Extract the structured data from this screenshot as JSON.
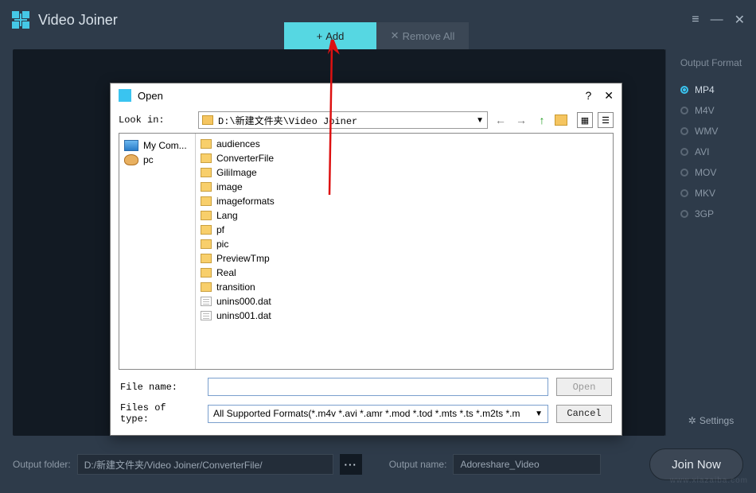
{
  "app": {
    "title": "Video Joiner",
    "win_menu_glyph": "≡",
    "win_min_glyph": "—",
    "win_close_glyph": "✕"
  },
  "tabs": {
    "add_label": "Add",
    "add_glyph": "+",
    "remove_label": "Remove All",
    "remove_glyph": "✕"
  },
  "sidebar": {
    "title": "Output Format",
    "formats": [
      "MP4",
      "M4V",
      "WMV",
      "AVI",
      "MOV",
      "MKV",
      "3GP"
    ],
    "selected_index": 0,
    "settings_label": "Settings"
  },
  "bottom": {
    "output_folder_label": "Output folder:",
    "output_folder_value": "D:/新建文件夹/Video Joiner/ConverterFile/",
    "output_name_label": "Output name:",
    "output_name_value": "Adoreshare_Video",
    "dots_label": "···",
    "join_label": "Join Now"
  },
  "dialog": {
    "title": "Open",
    "help_glyph": "?",
    "close_glyph": "✕",
    "lookin_label": "Look in:",
    "lookin_value": "D:\\新建文件夹\\Video Joiner",
    "nav_back_glyph": "←",
    "nav_fwd_glyph": "→",
    "nav_up_glyph": "↑",
    "view_grid_glyph": "▦",
    "view_list_glyph": "☰",
    "places": [
      {
        "label": "My Com...",
        "icon": "monitor"
      },
      {
        "label": "pc",
        "icon": "user"
      }
    ],
    "files": [
      {
        "name": "audiences",
        "type": "folder"
      },
      {
        "name": "ConverterFile",
        "type": "folder"
      },
      {
        "name": "GiliImage",
        "type": "folder"
      },
      {
        "name": "image",
        "type": "folder"
      },
      {
        "name": "imageformats",
        "type": "folder"
      },
      {
        "name": "Lang",
        "type": "folder"
      },
      {
        "name": "pf",
        "type": "folder"
      },
      {
        "name": "pic",
        "type": "folder"
      },
      {
        "name": "PreviewTmp",
        "type": "folder"
      },
      {
        "name": "Real",
        "type": "folder"
      },
      {
        "name": "transition",
        "type": "folder"
      },
      {
        "name": "unins000.dat",
        "type": "file"
      },
      {
        "name": "unins001.dat",
        "type": "file"
      }
    ],
    "file_name_label": "File name:",
    "file_name_value": "",
    "file_type_label": "Files of type:",
    "file_type_value": "All Supported Formats(*.m4v *.avi *.amr *.mod *.tod *.mts *.ts *.m2ts *.m ",
    "open_btn": "Open",
    "cancel_btn": "Cancel"
  },
  "watermark": "www.xiazaiba.com"
}
